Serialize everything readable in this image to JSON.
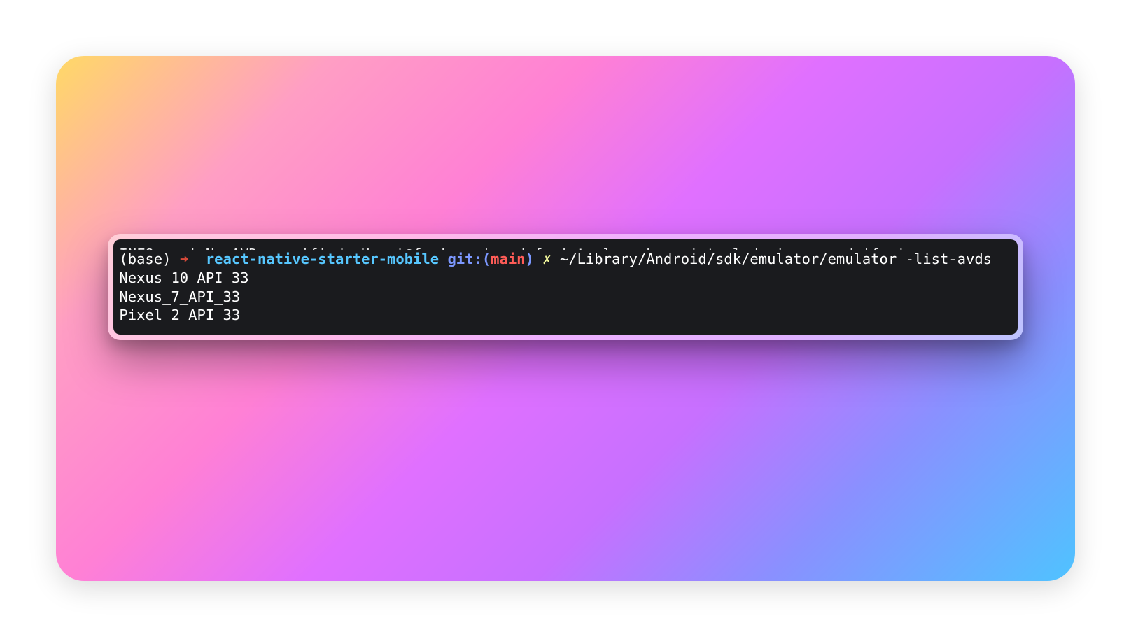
{
  "terminal": {
    "prompt": {
      "env": "(base)",
      "arrow": "➜",
      "directory": "react-native-starter-mobile",
      "git_label": "git:",
      "git_paren_open": "(",
      "branch": "main",
      "git_paren_close": ")",
      "dirty_marker": "✗"
    },
    "command": "~/Library/Android/sdk/emulator/emulator -list-avds",
    "output_lines": [
      "Nexus_10_API_33",
      "Nexus_7_API_33",
      "Pixel_2_API_33"
    ]
  },
  "colors": {
    "terminal_bg": "#1a1b1e",
    "text": "#ffffff",
    "arrow": "#d84a3a",
    "directory": "#57c7ff",
    "git_label": "#7c98ff",
    "branch": "#ff5c57",
    "dirty_marker": "#f3f99d"
  }
}
